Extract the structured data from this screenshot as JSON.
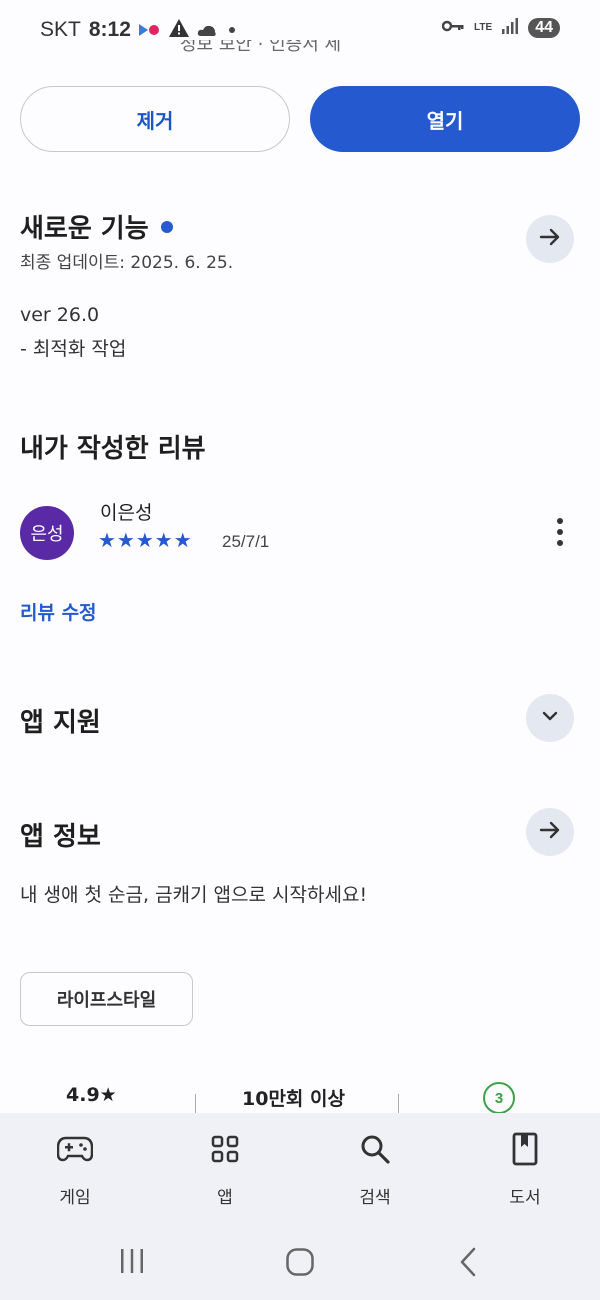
{
  "status_bar": {
    "carrier": "SKT",
    "time": "8:12",
    "network": "LTE",
    "battery": "44",
    "icons": [
      "cast-icon",
      "warning-icon",
      "cloud-icon",
      "dot-icon",
      "key-icon",
      "signal-icon"
    ]
  },
  "top_clipped_text": "정보 보안 · 인증서 세",
  "actions": {
    "remove_label": "제거",
    "open_label": "열기"
  },
  "whats_new": {
    "title": "새로운 기능",
    "updated": "최종 업데이트: 2025. 6. 25.",
    "lines": [
      "ver 26.0",
      "- 최적화 작업"
    ]
  },
  "my_review": {
    "title": "내가 작성한 리뷰",
    "avatar_text": "은성",
    "reviewer_name": "이은성",
    "stars": "★★★★★",
    "rating": 5,
    "date": "25/7/1",
    "edit_label": "리뷰 수정"
  },
  "app_support": {
    "title": "앱 지원"
  },
  "app_info": {
    "title": "앱 정보",
    "description": "내 생애 첫 순금, 금캐기 앱으로 시작하세요!",
    "category_chip": "라이프스타일"
  },
  "stats": {
    "rating": "4.9★",
    "downloads": "10만회 이상",
    "age_rating": "3"
  },
  "bottom_nav": {
    "items": [
      {
        "label": "게임",
        "icon": "gamepad-icon"
      },
      {
        "label": "앱",
        "icon": "apps-grid-icon"
      },
      {
        "label": "검색",
        "icon": "search-icon"
      },
      {
        "label": "도서",
        "icon": "book-icon"
      }
    ]
  },
  "colors": {
    "accent": "#2459cf",
    "avatar": "#5a2aa6",
    "age_badge": "#3ea04a",
    "nav_background": "#eff1f6"
  }
}
